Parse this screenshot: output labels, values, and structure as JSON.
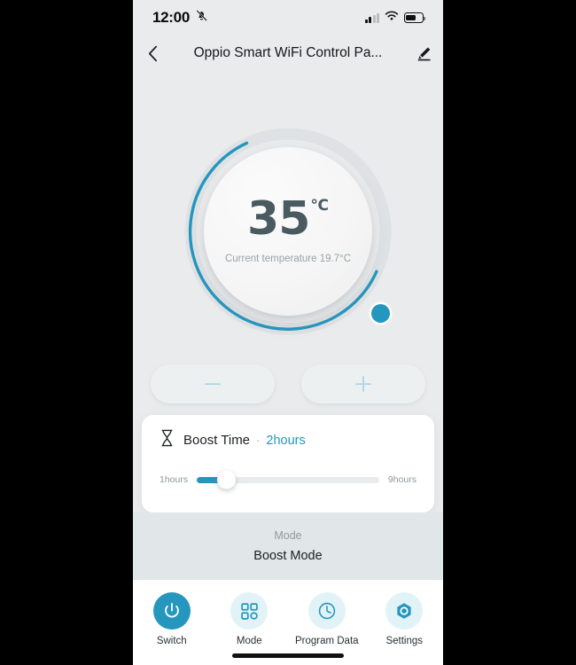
{
  "status_bar": {
    "time": "12:00",
    "bell_icon": "bell-muted-icon",
    "signal_icon": "cellular-signal-icon",
    "signal_bars_filled": 2,
    "signal_bars_total": 4,
    "wifi_icon": "wifi-icon",
    "battery_icon": "battery-icon",
    "battery_level_percent": 62
  },
  "header": {
    "back_icon": "chevron-left-icon",
    "title": "Oppio Smart WiFi Control Pa...",
    "edit_icon": "pencil-edit-icon"
  },
  "dial": {
    "target_temperature": "35",
    "unit": "℃",
    "current_temperature_text": "Current temperature 19.7°C",
    "arc_color": "#2596be",
    "track_color": "#dfe2e4",
    "knob_icon": "dial-knob"
  },
  "stepper": {
    "decrease_label": "−",
    "decrease_icon": "minus-icon",
    "increase_label": "+",
    "increase_icon": "plus-icon",
    "symbol_color": "#aad6e6"
  },
  "boost_card": {
    "icon": "hourglass-icon",
    "title": "Boost Time",
    "separator": "·",
    "value": "2hours",
    "value_color": "#2596be",
    "slider": {
      "min_label": "1hours",
      "max_label": "9hours",
      "fill_color": "#2596be",
      "track_color": "#e9ebec"
    }
  },
  "mode_section": {
    "label": "Mode",
    "value": "Boost Mode"
  },
  "bottom_nav": {
    "items": [
      {
        "label": "Switch",
        "icon": "power-icon",
        "active": true
      },
      {
        "label": "Mode",
        "icon": "grid-squares-icon",
        "active": false
      },
      {
        "label": "Program Data",
        "icon": "clock-icon",
        "active": false
      },
      {
        "label": "Settings",
        "icon": "hexagon-gear-icon",
        "active": false
      }
    ],
    "active_color": "#2596be",
    "inactive_bg": "#e2f3f8"
  },
  "home_indicator": "home-indicator-bar"
}
